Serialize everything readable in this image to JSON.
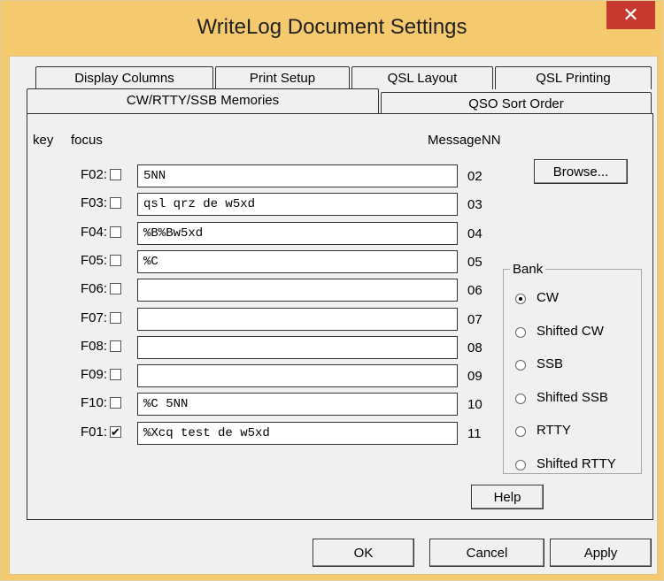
{
  "window": {
    "title": "WriteLog Document Settings",
    "close_glyph": "✕"
  },
  "tabs": {
    "row1": [
      "Display Columns",
      "Print Setup",
      "QSL Layout",
      "QSL Printing"
    ],
    "row2": [
      "CW/RTTY/SSB Memories",
      "QSO Sort Order"
    ],
    "active": "CW/RTTY/SSB Memories"
  },
  "headers": {
    "key": "key",
    "focus": "focus",
    "message": "MessageNN"
  },
  "rows": [
    {
      "key": "F02:",
      "checked": false,
      "value": "5NN",
      "nn": "02"
    },
    {
      "key": "F03:",
      "checked": false,
      "value": "qsl qrz de w5xd",
      "nn": "03"
    },
    {
      "key": "F04:",
      "checked": false,
      "value": "%B%Bw5xd",
      "nn": "04"
    },
    {
      "key": "F05:",
      "checked": false,
      "value": "%C",
      "nn": "05"
    },
    {
      "key": "F06:",
      "checked": false,
      "value": "",
      "nn": "06"
    },
    {
      "key": "F07:",
      "checked": false,
      "value": "",
      "nn": "07"
    },
    {
      "key": "F08:",
      "checked": false,
      "value": "",
      "nn": "08"
    },
    {
      "key": "F09:",
      "checked": false,
      "value": "",
      "nn": "09"
    },
    {
      "key": "F10:",
      "checked": false,
      "value": "%C 5NN",
      "nn": "10"
    },
    {
      "key": "F01:",
      "checked": true,
      "value": "%Xcq test de w5xd",
      "nn": "11"
    }
  ],
  "browse_label": "Browse...",
  "bank": {
    "label": "Bank",
    "options": [
      "CW",
      "Shifted CW",
      "SSB",
      "Shifted SSB",
      "RTTY",
      "Shifted RTTY"
    ],
    "selected": "CW"
  },
  "buttons": {
    "help": "Help",
    "ok": "OK",
    "cancel": "Cancel",
    "apply": "Apply"
  },
  "colors": {
    "title_bg": "#f5c96d",
    "close_bg": "#c7392e",
    "dialog_bg": "#f0f0f0"
  },
  "icons": {
    "close": "close-icon",
    "check": "check-icon"
  }
}
